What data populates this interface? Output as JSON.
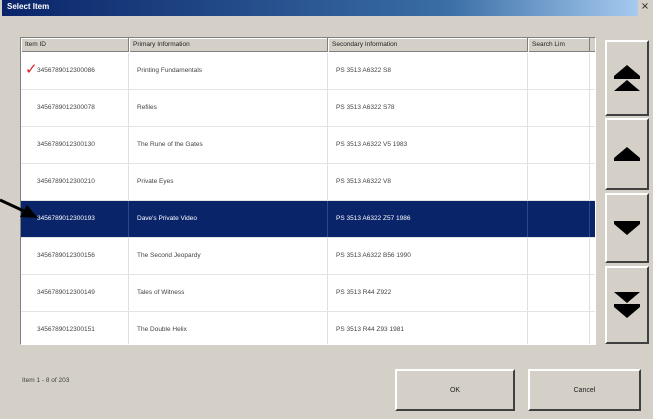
{
  "window": {
    "title": "Select Item",
    "close_glyph": "×"
  },
  "grid": {
    "columns": [
      "Item ID",
      "Primary Information",
      "Secondary Information",
      "Search Lim"
    ],
    "rows": [
      {
        "id": "3456789012300086",
        "primary": "Printing Fundamentals",
        "secondary": "PS 3513 A6322 S8",
        "checked": true,
        "selected": false
      },
      {
        "id": "3456789012300078",
        "primary": "Refiles",
        "secondary": "PS 3513 A6322 S78",
        "checked": false,
        "selected": false
      },
      {
        "id": "3456789012300130",
        "primary": "The Rune of the Gates",
        "secondary": "PS 3513 A6322 V5 1983",
        "checked": false,
        "selected": false
      },
      {
        "id": "3456789012300210",
        "primary": "Private Eyes",
        "secondary": "PS 3513 A6322 V8",
        "checked": false,
        "selected": false
      },
      {
        "id": "3456789012300193",
        "primary": "Dave's Private Video",
        "secondary": "PS 3513 A6322 Z57 1986",
        "checked": false,
        "selected": true
      },
      {
        "id": "3456789012300156",
        "primary": "The Second Jeopardy",
        "secondary": "PS 3513 A6322 B56 1990",
        "checked": false,
        "selected": false
      },
      {
        "id": "3456789012300149",
        "primary": "Tales of Witness",
        "secondary": "PS 3513 R44 Z922",
        "checked": false,
        "selected": false
      },
      {
        "id": "3456789012300151",
        "primary": "The Double Helix",
        "secondary": "PS 3513 R44 Z93 1981",
        "checked": false,
        "selected": false
      }
    ]
  },
  "status": {
    "text": "Item 1 - 8 of 203"
  },
  "buttons": {
    "ok": "OK",
    "cancel": "Cancel"
  },
  "icons": {
    "scroll_top": "double-up-arrow-icon",
    "scroll_up": "up-arrow-icon",
    "scroll_down": "down-arrow-icon",
    "scroll_bottom": "double-down-arrow-icon",
    "check": "✓"
  },
  "colors": {
    "selection": "#0a246a",
    "check": "#dd2222",
    "title_bar": "#0a246a"
  }
}
